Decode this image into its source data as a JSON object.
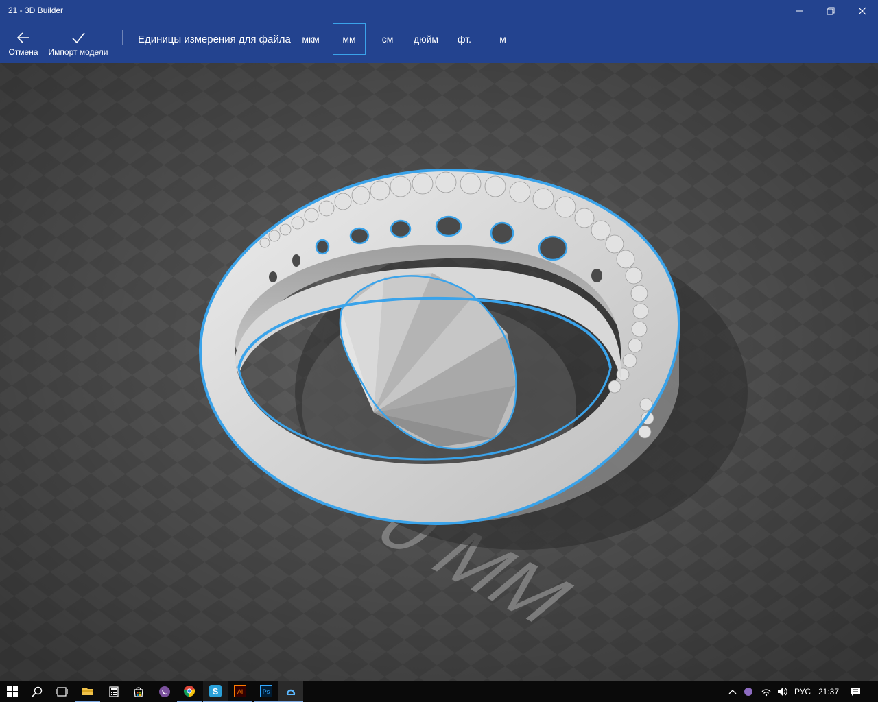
{
  "window": {
    "title": "21 - 3D Builder"
  },
  "toolbar": {
    "cancel_label": "Отмена",
    "import_label": "Импорт модели",
    "units_label": "Единицы измерения для файла",
    "units": [
      "мкм",
      "мм",
      "см",
      "дюйм",
      "фт.",
      "м"
    ],
    "selected_unit": "мм"
  },
  "viewport": {
    "floor_label": "0 MM",
    "selection_color": "#3aa3ea",
    "background_color": "#5c5c5c"
  },
  "taskbar": {
    "apps": [
      "start-icon",
      "search-icon",
      "task-view-icon",
      "file-explorer-icon",
      "calculator-icon",
      "store-icon",
      "viber-icon",
      "chrome-icon",
      "skype-icon",
      "illustrator-icon",
      "photoshop-icon",
      "3d-builder-icon"
    ],
    "language": "РУС",
    "time": "21:37"
  }
}
